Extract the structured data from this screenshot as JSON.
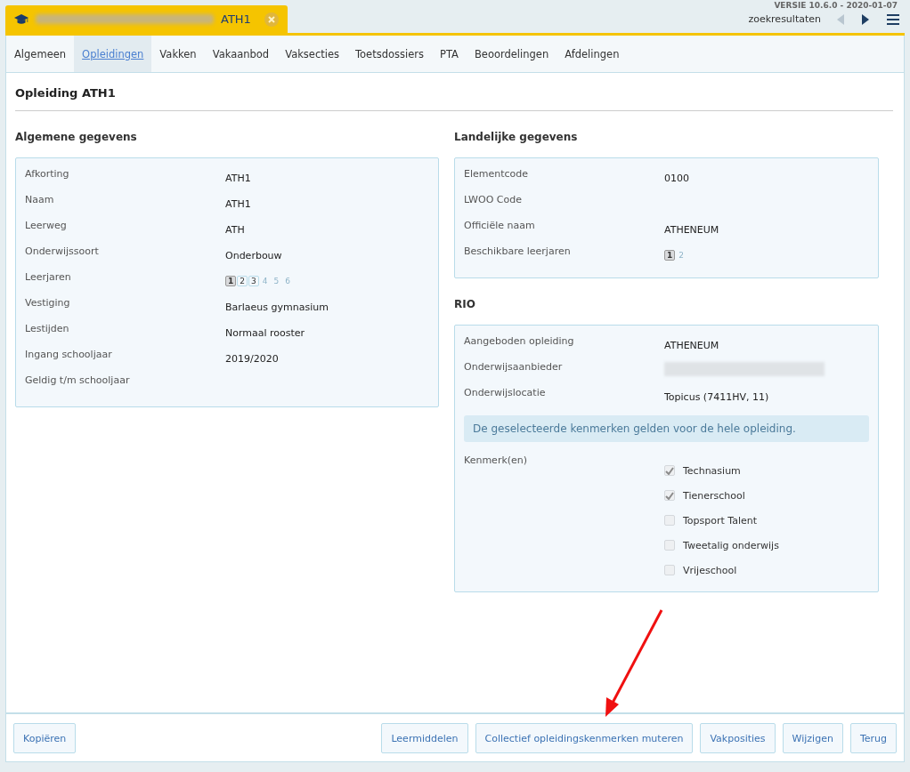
{
  "version": "VERSIE 10.6.0 - 2020-01-07",
  "document_tab": {
    "title": "ATH1"
  },
  "header": {
    "search_results": "zoekresultaten"
  },
  "tabs": [
    {
      "label": "Algemeen",
      "selected": false
    },
    {
      "label": "Opleidingen",
      "selected": true
    },
    {
      "label": "Vakken",
      "selected": false
    },
    {
      "label": "Vakaanbod",
      "selected": false
    },
    {
      "label": "Vaksecties",
      "selected": false
    },
    {
      "label": "Toetsdossiers",
      "selected": false
    },
    {
      "label": "PTA",
      "selected": false
    },
    {
      "label": "Beoordelingen",
      "selected": false
    },
    {
      "label": "Afdelingen",
      "selected": false
    }
  ],
  "page_title": "Opleiding ATH1",
  "general": {
    "heading": "Algemene gegevens",
    "fields": [
      {
        "kind": "text",
        "label": "Afkorting",
        "value": "ATH1"
      },
      {
        "kind": "text",
        "label": "Naam",
        "value": "ATH1"
      },
      {
        "kind": "text",
        "label": "Leerweg",
        "value": "ATH"
      },
      {
        "kind": "text",
        "label": "Onderwijssoort",
        "value": "Onderbouw"
      },
      {
        "kind": "years",
        "label": "Leerjaren",
        "years": [
          {
            "label": "1",
            "selected": true,
            "disabled": false
          },
          {
            "label": "2",
            "selected": false,
            "disabled": false
          },
          {
            "label": "3",
            "selected": false,
            "disabled": false
          },
          {
            "label": "4",
            "selected": false,
            "disabled": true
          },
          {
            "label": "5",
            "selected": false,
            "disabled": true
          },
          {
            "label": "6",
            "selected": false,
            "disabled": true
          }
        ]
      },
      {
        "kind": "text",
        "label": "Vestiging",
        "value": "Barlaeus gymnasium"
      },
      {
        "kind": "text",
        "label": "Lestijden",
        "value": "Normaal rooster"
      },
      {
        "kind": "text",
        "label": "Ingang schooljaar",
        "value": "2019/2020"
      },
      {
        "kind": "text",
        "label": "Geldig t/m schooljaar"
      }
    ]
  },
  "national": {
    "heading": "Landelijke gegevens",
    "fields": [
      {
        "kind": "text",
        "label": "Elementcode",
        "value": "0100"
      },
      {
        "kind": "text",
        "label": "LWOO Code"
      },
      {
        "kind": "text",
        "label": "Officiële naam",
        "value": "ATHENEUM"
      },
      {
        "kind": "years",
        "label": "Beschikbare leerjaren",
        "years": [
          {
            "label": "1",
            "selected": true,
            "disabled": false
          },
          {
            "label": "2",
            "selected": false,
            "disabled": true
          }
        ]
      }
    ]
  },
  "rio": {
    "heading": "RIO",
    "fields": [
      {
        "kind": "text",
        "label": "Aangeboden opleiding",
        "value": "ATHENEUM"
      },
      {
        "kind": "redacted",
        "label": "Onderwijsaanbieder"
      },
      {
        "kind": "text",
        "label": "Onderwijslocatie",
        "value": "Topicus (7411HV, 11)"
      }
    ],
    "notice": "De geselecteerde kenmerken gelden voor de hele opleiding.",
    "features_label": "Kenmerk(en)",
    "features": [
      {
        "label": "Technasium",
        "checked": true
      },
      {
        "label": "Tienerschool",
        "checked": true
      },
      {
        "label": "Topsport Talent",
        "checked": false
      },
      {
        "label": "Tweetalig onderwijs",
        "checked": false
      },
      {
        "label": "Vrijeschool",
        "checked": false
      }
    ]
  },
  "footer": {
    "left_buttons": [
      "Kopiëren"
    ],
    "right_buttons": [
      "Leermiddelen",
      "Collectief opleidingskenmerken muteren",
      "Vakposities",
      "Wijzigen",
      "Terug"
    ]
  }
}
